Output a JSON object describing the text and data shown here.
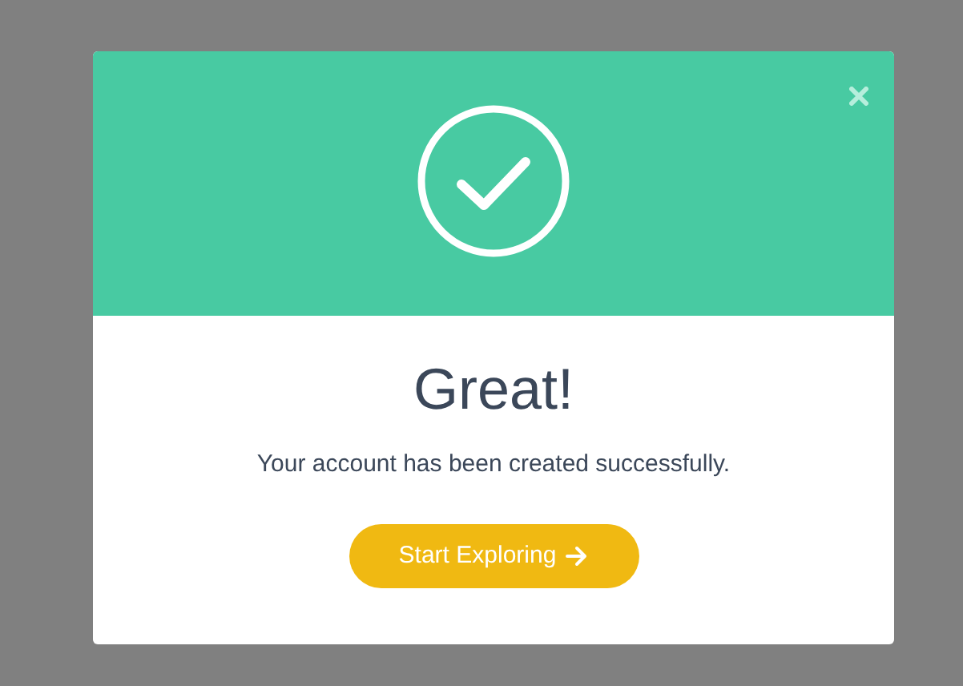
{
  "dialog": {
    "title": "Great!",
    "message": "Your account has been created successfully.",
    "button": "Start Exploring"
  }
}
